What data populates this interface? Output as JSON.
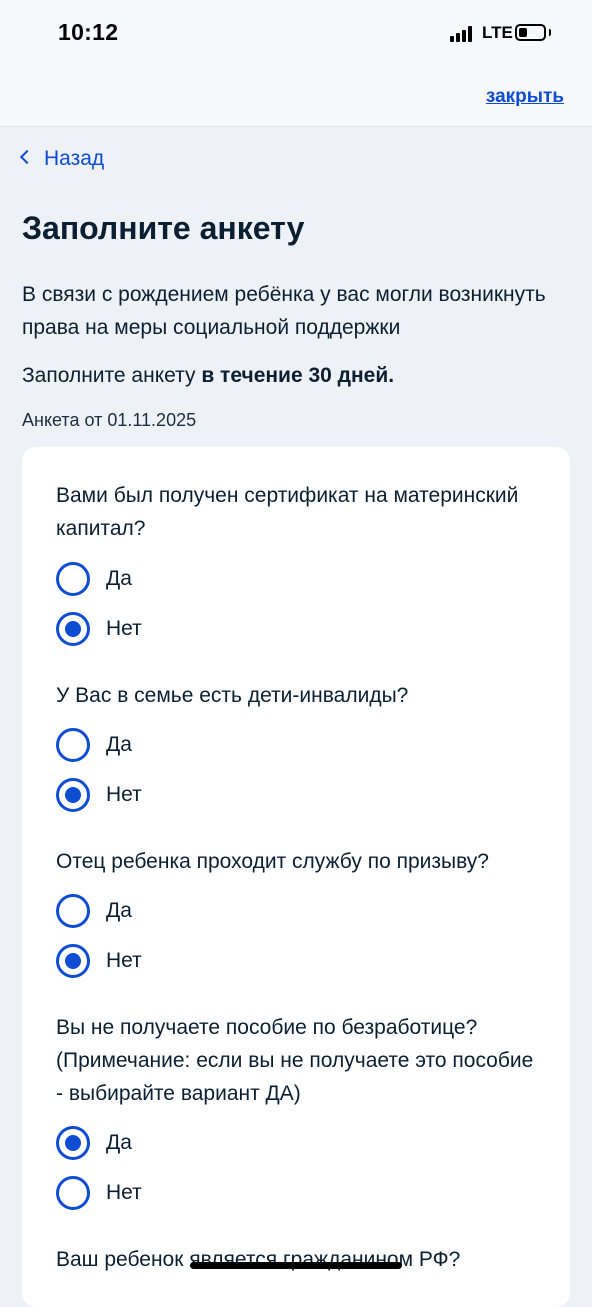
{
  "status_bar": {
    "time": "10:12",
    "network": "LTE",
    "battery_level": 0.35,
    "signal_bars": 4
  },
  "header": {
    "close_label": "закрыть"
  },
  "nav": {
    "back_label": "Назад"
  },
  "page": {
    "title": "Заполните анкету",
    "intro": "В связи с рождением ребёнка у вас могли возникнуть права на меры социальной поддержки",
    "deadline_prefix": "Заполните анкету ",
    "deadline_bold": "в течение 30 дней.",
    "form_date": "Анкета от 01.11.2025"
  },
  "questions": [
    {
      "text": "Вами был получен сертификат на материнский капитал?",
      "options": [
        {
          "label": "Да",
          "selected": false
        },
        {
          "label": "Нет",
          "selected": true
        }
      ]
    },
    {
      "text": "У Вас в семье есть дети-инвалиды?",
      "options": [
        {
          "label": "Да",
          "selected": false
        },
        {
          "label": "Нет",
          "selected": true
        }
      ]
    },
    {
      "text": "Отец ребенка проходит службу по призыву?",
      "options": [
        {
          "label": "Да",
          "selected": false
        },
        {
          "label": "Нет",
          "selected": true
        }
      ]
    },
    {
      "text": "Вы не получаете пособие по безработице? (Примечание: если вы не получаете это пособие - выбирайте вариант ДА)",
      "options": [
        {
          "label": "Да",
          "selected": true
        },
        {
          "label": "Нет",
          "selected": false
        }
      ]
    },
    {
      "text": "Ваш ребенок является гражданином РФ?",
      "options": []
    }
  ],
  "colors": {
    "accent": "#0d4cd3",
    "background": "#eef1f6",
    "card": "#ffffff",
    "text": "#0b1f33"
  }
}
